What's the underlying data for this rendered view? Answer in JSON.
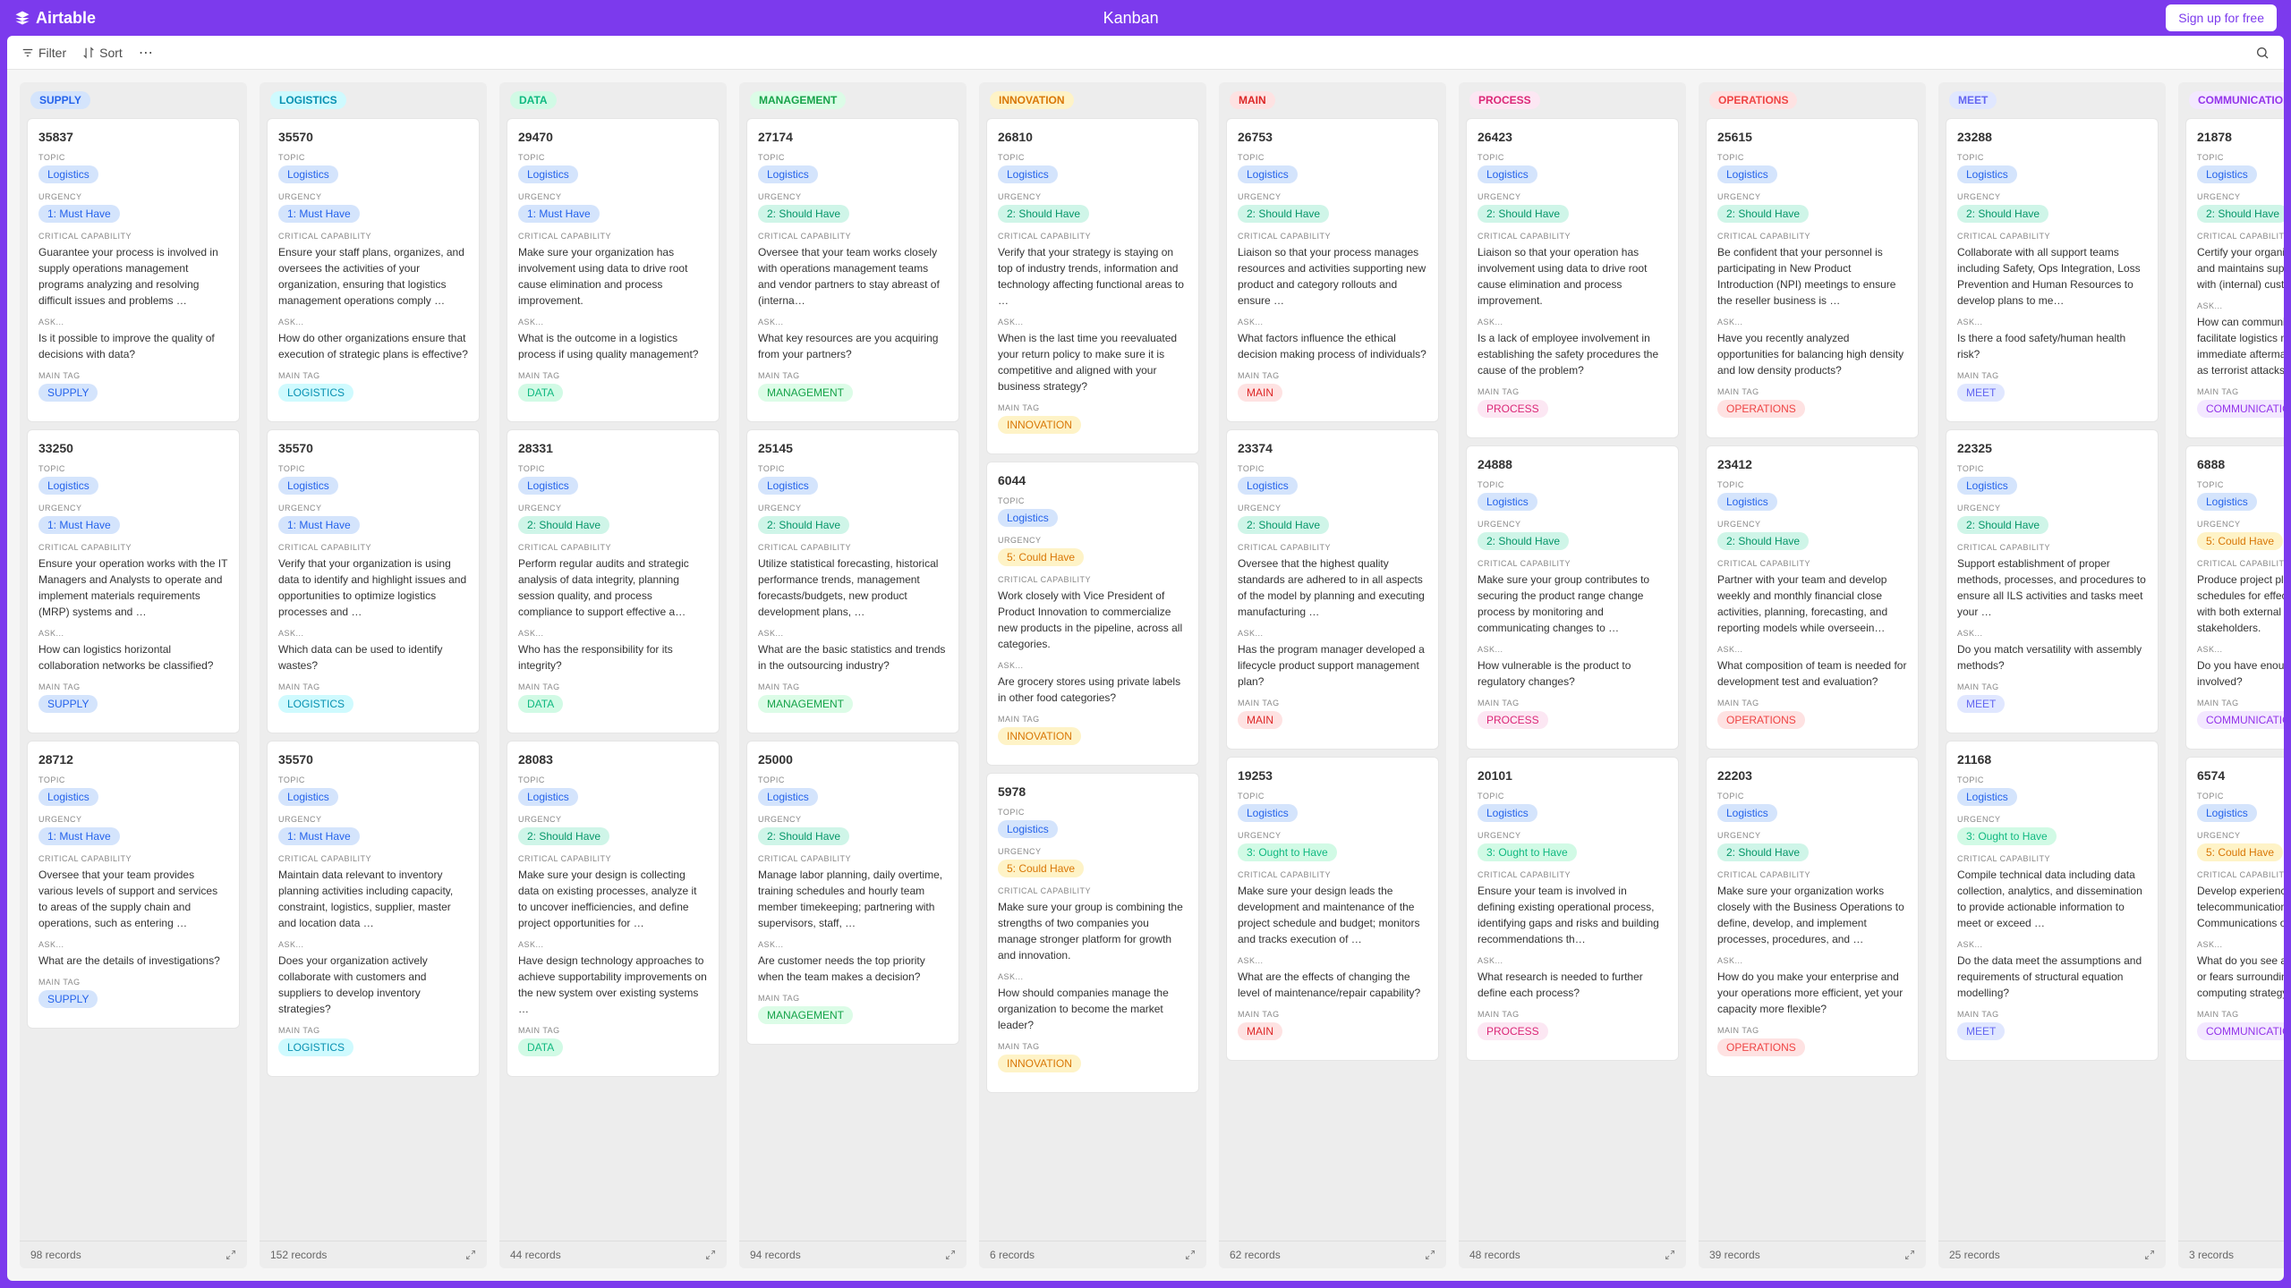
{
  "header": {
    "brand": "Airtable",
    "title": "Kanban",
    "signup": "Sign up for free"
  },
  "toolbar": {
    "filter": "Filter",
    "sort": "Sort"
  },
  "urgency": {
    "must": "1: Must Have",
    "should": "2: Should Have",
    "could": "5: Could Have",
    "ought": "3: Ought to Have"
  },
  "labels": {
    "topic": "TOPIC",
    "urgency": "URGENCY",
    "critical": "CRITICAL CAPABILITY",
    "ask": "ASK...",
    "main_tag": "MAIN TAG"
  },
  "topic_value": "Logistics",
  "columns": [
    {
      "name": "SUPPLY",
      "tagClass": "tag-supply",
      "records": "98 records",
      "cards": [
        {
          "id": "35837",
          "urgency": "must",
          "critical": "Guarantee your process is involved in supply operations management programs analyzing and resolving difficult issues and problems …",
          "ask": "Is it possible to improve the quality of decisions with data?"
        },
        {
          "id": "33250",
          "urgency": "must",
          "critical": "Ensure your operation works with the IT Managers and Analysts to operate and implement materials requirements (MRP) systems and …",
          "ask": "How can logistics horizontal collaboration networks be classified?"
        },
        {
          "id": "28712",
          "urgency": "must",
          "critical": "Oversee that your team provides various levels of support and services to areas of the supply chain and operations, such as entering …",
          "ask": "What are the details of investigations?"
        }
      ]
    },
    {
      "name": "LOGISTICS",
      "tagClass": "tag-logistics",
      "records": "152 records",
      "cards": [
        {
          "id": "35570",
          "urgency": "must",
          "critical": "Ensure your staff plans, organizes, and oversees the activities of your organization, ensuring that logistics management operations comply …",
          "ask": "How do other organizations ensure that execution of strategic plans is effective?"
        },
        {
          "id": "35570",
          "urgency": "must",
          "critical": "Verify that your organization is using data to identify and highlight issues and opportunities to optimize logistics processes and …",
          "ask": "Which data can be used to identify wastes?"
        },
        {
          "id": "35570",
          "urgency": "must",
          "critical": "Maintain data relevant to inventory planning activities including capacity, constraint, logistics, supplier, master and location data …",
          "ask": "Does your organization actively collaborate with customers and suppliers to develop inventory strategies?"
        }
      ]
    },
    {
      "name": "DATA",
      "tagClass": "tag-data",
      "records": "44 records",
      "cards": [
        {
          "id": "29470",
          "urgency": "must",
          "critical": "Make sure your organization has involvement using data to drive root cause elimination and process improvement.",
          "ask": "What is the outcome in a logistics process if using quality management?"
        },
        {
          "id": "28331",
          "urgency": "should",
          "critical": "Perform regular audits and strategic analysis of data integrity, planning session quality, and process compliance to support effective a…",
          "ask": "Who has the responsibility for its integrity?"
        },
        {
          "id": "28083",
          "urgency": "should",
          "critical": "Make sure your design is collecting data on existing processes, analyze it to uncover inefficiencies, and define project opportunities for …",
          "ask": "Have design technology approaches to achieve supportability improvements on the new system over existing systems …"
        }
      ]
    },
    {
      "name": "MANAGEMENT",
      "tagClass": "tag-management",
      "records": "94 records",
      "cards": [
        {
          "id": "27174",
          "urgency": "should",
          "critical": "Oversee that your team works closely with operations management teams and vendor partners to stay abreast of (interna…",
          "ask": "What key resources are you acquiring from your partners?"
        },
        {
          "id": "25145",
          "urgency": "should",
          "critical": "Utilize statistical forecasting, historical performance trends, management forecasts/budgets, new product development plans, …",
          "ask": "What are the basic statistics and trends in the outsourcing industry?"
        },
        {
          "id": "25000",
          "urgency": "should",
          "critical": "Manage labor planning, daily overtime, training schedules and hourly team member timekeeping; partnering with supervisors, staff, …",
          "ask": "Are customer needs the top priority when the team makes a decision?"
        }
      ]
    },
    {
      "name": "INNOVATION",
      "tagClass": "tag-innovation",
      "records": "6 records",
      "cards": [
        {
          "id": "26810",
          "urgency": "should",
          "critical": "Verify that your strategy is staying on top of industry trends, information and technology affecting functional areas to …",
          "ask": "When is the last time you reevaluated your return policy to make sure it is competitive and aligned with your business strategy?"
        },
        {
          "id": "6044",
          "urgency": "could",
          "critical": "Work closely with Vice President of Product Innovation to commercialize new products in the pipeline, across all categories.",
          "ask": "Are grocery stores using private labels in other food categories?"
        },
        {
          "id": "5978",
          "urgency": "could",
          "critical": "Make sure your group is combining the strengths of two companies you manage stronger platform for growth and innovation.",
          "ask": "How should companies manage the organization to become the market leader?"
        }
      ]
    },
    {
      "name": "MAIN",
      "tagClass": "tag-main",
      "records": "62 records",
      "cards": [
        {
          "id": "26753",
          "urgency": "should",
          "critical": "Liaison so that your process manages resources and activities supporting new product and category rollouts and ensure …",
          "ask": "What factors influence the ethical decision making process of individuals?"
        },
        {
          "id": "23374",
          "urgency": "should",
          "critical": "Oversee that the highest quality standards are adhered to in all aspects of the model by planning and executing manufacturing …",
          "ask": "Has the program manager developed a lifecycle product support management plan?"
        },
        {
          "id": "19253",
          "urgency": "ought",
          "critical": "Make sure your design leads the development and maintenance of the project schedule and budget; monitors and tracks execution of …",
          "ask": "What are the effects of changing the level of maintenance/repair capability?"
        }
      ]
    },
    {
      "name": "PROCESS",
      "tagClass": "tag-process",
      "records": "48 records",
      "cards": [
        {
          "id": "26423",
          "urgency": "should",
          "critical": "Liaison so that your operation has involvement using data to drive root cause elimination and process improvement.",
          "ask": "Is a lack of employee involvement in establishing the safety procedures the cause of the problem?"
        },
        {
          "id": "24888",
          "urgency": "should",
          "critical": "Make sure your group contributes to securing the product range change process by monitoring and communicating changes to …",
          "ask": "How vulnerable is the product to regulatory changes?"
        },
        {
          "id": "20101",
          "urgency": "ought",
          "critical": "Ensure your team is involved in defining existing operational process, identifying gaps and risks and building recommendations th…",
          "ask": "What research is needed to further define each process?"
        }
      ]
    },
    {
      "name": "OPERATIONS",
      "tagClass": "tag-operations",
      "records": "39 records",
      "cards": [
        {
          "id": "25615",
          "urgency": "should",
          "critical": "Be confident that your personnel is participating in New Product Introduction (NPI) meetings to ensure the reseller business is …",
          "ask": "Have you recently analyzed opportunities for balancing high density and low density products?"
        },
        {
          "id": "23412",
          "urgency": "should",
          "critical": "Partner with your team and develop weekly and monthly financial close activities, planning, forecasting, and reporting models while overseein…",
          "ask": "What composition of team is needed for development test and evaluation?"
        },
        {
          "id": "22203",
          "urgency": "should",
          "critical": "Make sure your organization works closely with the Business Operations to define, develop, and implement processes, procedures, and …",
          "ask": "How do you make your enterprise and your operations more efficient, yet your capacity more flexible?"
        }
      ]
    },
    {
      "name": "MEET",
      "tagClass": "tag-meet",
      "records": "25 records",
      "cards": [
        {
          "id": "23288",
          "urgency": "should",
          "critical": "Collaborate with all support teams including Safety, Ops Integration, Loss Prevention and Human Resources to develop plans to me…",
          "ask": "Is there a food safety/human health risk?"
        },
        {
          "id": "22325",
          "urgency": "should",
          "critical": "Support establishment of proper methods, processes, and procedures to ensure all ILS activities and tasks meet your …",
          "ask": "Do you match versatility with assembly methods?"
        },
        {
          "id": "21168",
          "urgency": "ought",
          "critical": "Compile technical data including data collection, analytics, and dissemination to provide actionable information to meet or exceed …",
          "ask": "Do the data meet the assumptions and requirements of structural equation modelling?"
        }
      ]
    },
    {
      "name": "COMMUNICATION",
      "tagClass": "tag-communication",
      "records": "3 records",
      "cards": [
        {
          "id": "21878",
          "urgency": "should",
          "critical": "Certify your organization establishes and maintains supportive relationships with (internal) customers; supplie…",
          "ask": "How can communication be used to facilitate logistics management in the immediate aftermath of such situations as terrorist attacks?"
        },
        {
          "id": "6888",
          "urgency": "could",
          "critical": "Produce project plans and production schedules for effective communication with both external and internal stakeholders.",
          "ask": "Do you have enough stakeholders involved?"
        },
        {
          "id": "6574",
          "urgency": "could",
          "critical": "Develop experience working in a telecommunications field, Unified Communications or Cloud delivery.",
          "ask": "What do you see as the main concerns or fears surrounding the use of a cloud computing strategy?"
        }
      ]
    }
  ]
}
